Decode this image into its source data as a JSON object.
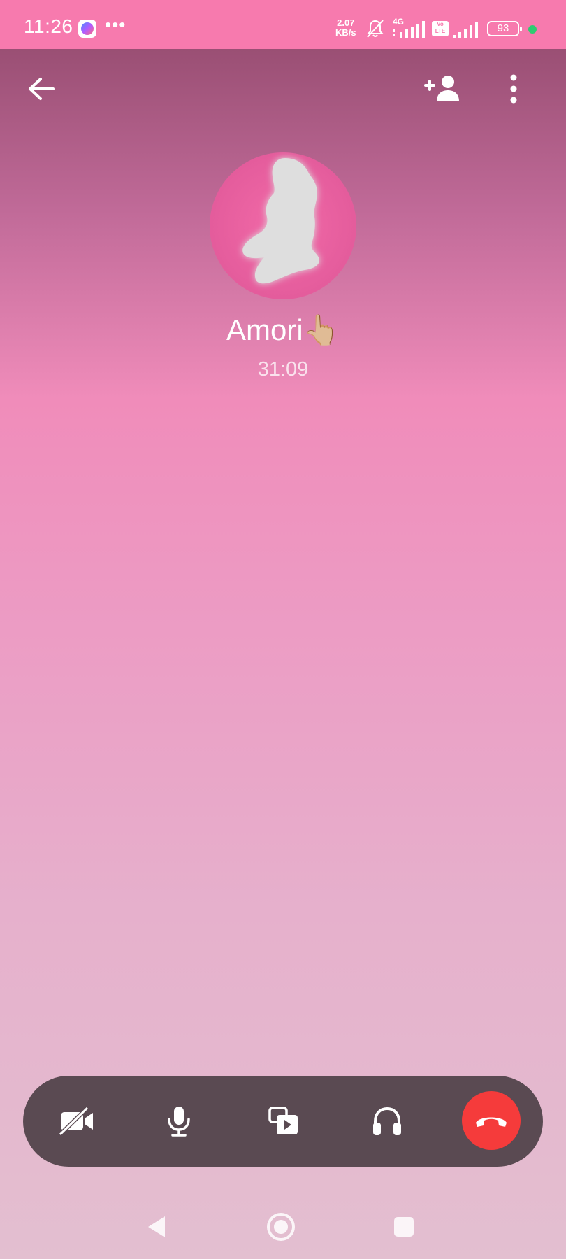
{
  "status_bar": {
    "time": "11:26",
    "more_indicator": "•••",
    "net_speed_value": "2.07",
    "net_speed_unit": "KB/s",
    "network_type": "4G",
    "volte_label": "Vo LTE",
    "battery_level": "93",
    "icons": [
      "messenger-icon",
      "bell-off-icon",
      "signal-icon",
      "volte-icon",
      "battery-icon"
    ],
    "dot_color": "#2ecc71"
  },
  "header": {
    "back_icon": "arrow-left-icon",
    "add_person_icon": "add-person-icon",
    "more_icon": "more-vertical-icon"
  },
  "contact": {
    "name": "Amori👆🏼",
    "duration": "31:09",
    "avatar_icon": "silhouette-avatar-icon"
  },
  "controls": {
    "icons": [
      "video-off-icon",
      "microphone-icon",
      "share-media-icon",
      "headphones-icon",
      "end-call-icon"
    ],
    "bar_color": "#5a4a52",
    "end_call_color": "#f53b3b"
  },
  "nav": {
    "icons": [
      "nav-back-icon",
      "nav-home-icon",
      "nav-recents-icon"
    ]
  },
  "theme": {
    "status_bar_color": "#f77aae",
    "accent": "#f08cba"
  }
}
